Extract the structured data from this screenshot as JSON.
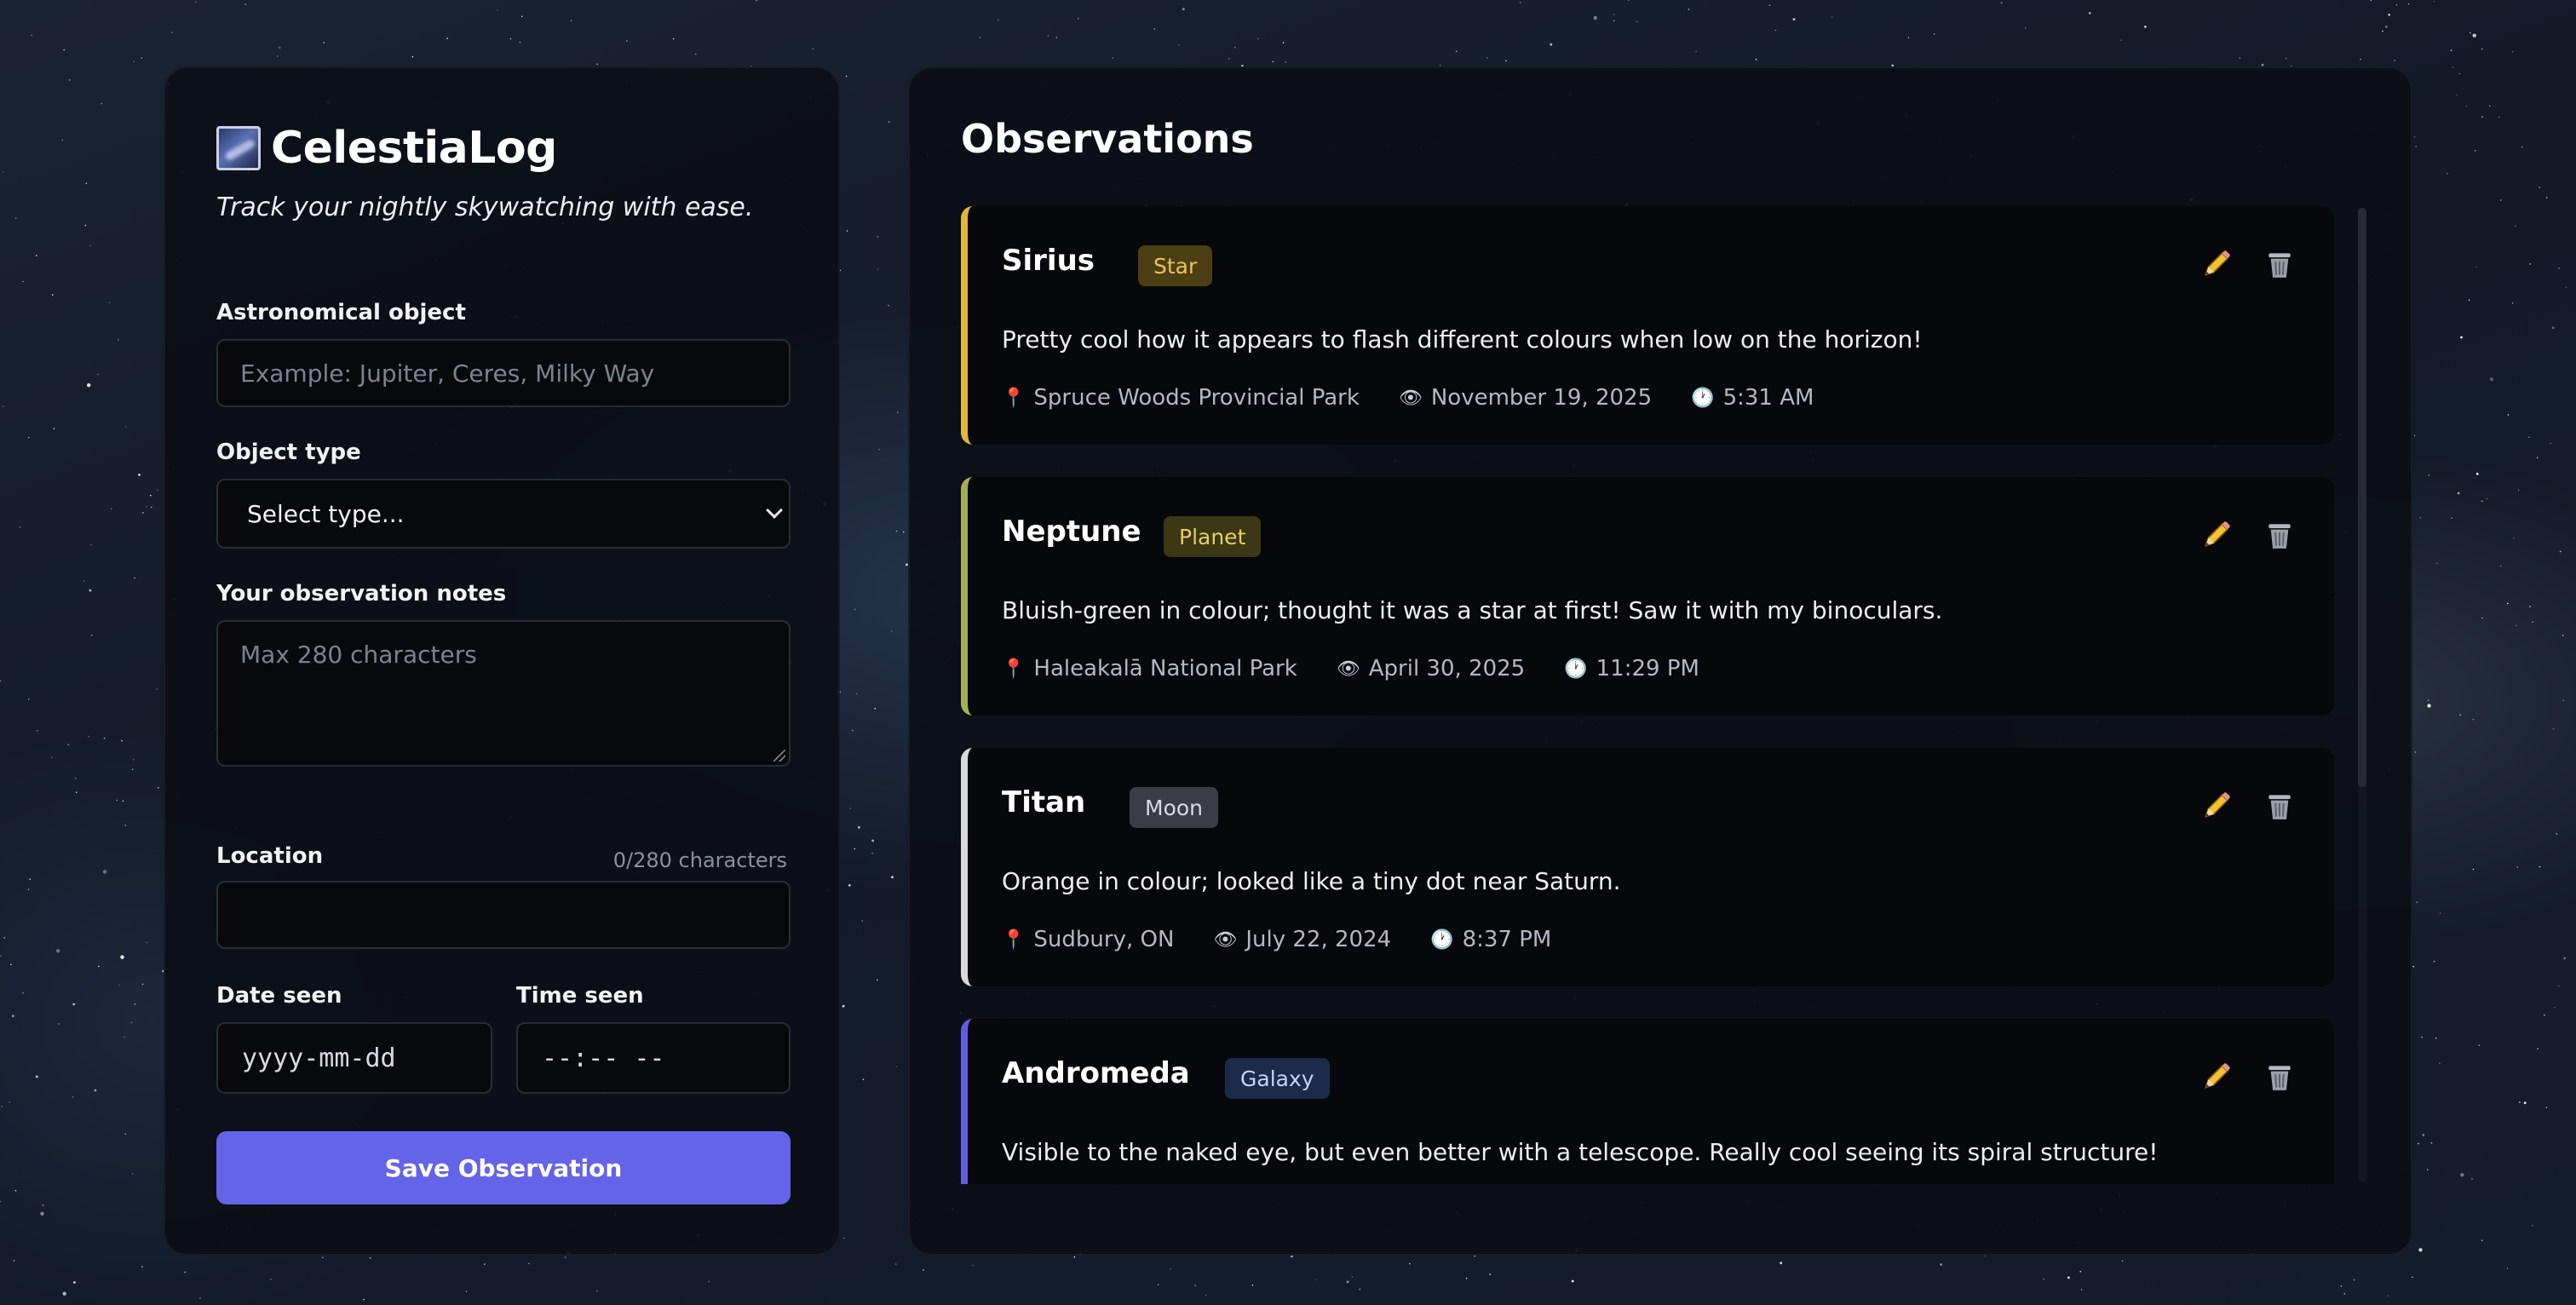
{
  "app": {
    "name": "CelestiaLog",
    "tagline": "Track your nightly skywatching with ease."
  },
  "form": {
    "object_label": "Astronomical object",
    "object_placeholder": "Example: Jupiter, Ceres, Milky Way",
    "object_value": "",
    "type_label": "Object type",
    "type_selected": "Select type...",
    "notes_label": "Your observation notes",
    "notes_placeholder": "Max 280 characters",
    "char_count": "0/280 characters",
    "location_label": "Location",
    "location_value": "",
    "date_label": "Date seen",
    "date_value": "yyyy-mm-dd",
    "time_label": "Time seen",
    "time_value": "--:-- --",
    "save_label": "Save Observation"
  },
  "observations_title": "Observations",
  "observations": [
    {
      "name": "Sirius",
      "type": "Star",
      "notes": "Pretty cool how it appears to flash different colours when low on the horizon!",
      "location": "Spruce Woods Provincial Park",
      "date": "November 19, 2025",
      "time": "5:31 AM",
      "accent": "#e3b53c",
      "badge_bg": "#4d3f14",
      "badge_fg": "#e9c45c"
    },
    {
      "name": "Neptune",
      "type": "Planet",
      "notes": "Bluish-green in colour; thought it was a star at first! Saw it with my binoculars.",
      "location": "Haleakalā National Park",
      "date": "April 30, 2025",
      "time": "11:29 PM",
      "accent": "#a7ad52",
      "badge_bg": "#3c3715",
      "badge_fg": "#e2cf66"
    },
    {
      "name": "Titan",
      "type": "Moon",
      "notes": "Orange in colour; looked like a tiny dot near Saturn.",
      "location": "Sudbury, ON",
      "date": "July 22, 2024",
      "time": "8:37 PM",
      "accent": "#d8d8de",
      "badge_bg": "#3a3d45",
      "badge_fg": "#d9dbe0"
    },
    {
      "name": "Andromeda",
      "type": "Galaxy",
      "notes": "Visible to the naked eye, but even better with a telescope. Really cool seeing its spiral structure!",
      "location": "",
      "date": "",
      "time": "",
      "accent": "#5e5ee0",
      "badge_bg": "#1d2b4a",
      "badge_fg": "#c7d3ef"
    }
  ],
  "icons": {
    "pin": "pin-icon",
    "eye": "eye-icon",
    "clock": "clock-icon",
    "edit": "pencil-icon",
    "delete": "trash-icon"
  }
}
